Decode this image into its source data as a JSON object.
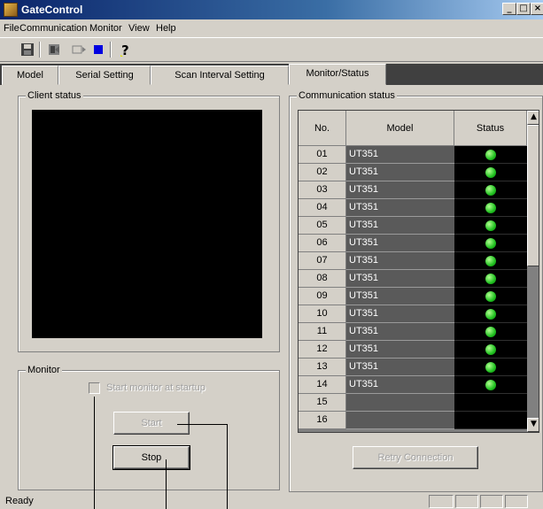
{
  "window": {
    "title": "GateControl"
  },
  "menu": [
    "File",
    "Communication",
    "Monitor",
    "View",
    "Help"
  ],
  "toolbar": [
    "save-icon",
    "tool-icon",
    "monitor-icon",
    "stop-icon",
    "help-icon"
  ],
  "tabs": [
    {
      "label": "Model",
      "active": false
    },
    {
      "label": "Serial Setting",
      "active": false
    },
    {
      "label": "Scan Interval Setting",
      "active": false
    },
    {
      "label": "Monitor/Status",
      "active": true
    }
  ],
  "client": {
    "group_label": "Client status"
  },
  "monitor": {
    "group_label": "Monitor",
    "startup_checkbox_label": "Start monitor at startup",
    "start_button": "Start",
    "stop_button": "Stop"
  },
  "communication": {
    "group_label": "Communication status",
    "headers": [
      "No.",
      "Model",
      "Status"
    ],
    "rows": [
      {
        "no": "01",
        "model": "UT351",
        "connected": true
      },
      {
        "no": "02",
        "model": "UT351",
        "connected": true
      },
      {
        "no": "03",
        "model": "UT351",
        "connected": true
      },
      {
        "no": "04",
        "model": "UT351",
        "connected": true
      },
      {
        "no": "05",
        "model": "UT351",
        "connected": true
      },
      {
        "no": "06",
        "model": "UT351",
        "connected": true
      },
      {
        "no": "07",
        "model": "UT351",
        "connected": true
      },
      {
        "no": "08",
        "model": "UT351",
        "connected": true
      },
      {
        "no": "09",
        "model": "UT351",
        "connected": true
      },
      {
        "no": "10",
        "model": "UT351",
        "connected": true
      },
      {
        "no": "11",
        "model": "UT351",
        "connected": true
      },
      {
        "no": "12",
        "model": "UT351",
        "connected": true
      },
      {
        "no": "13",
        "model": "UT351",
        "connected": true
      },
      {
        "no": "14",
        "model": "UT351",
        "connected": true
      },
      {
        "no": "15",
        "model": "",
        "connected": false
      },
      {
        "no": "16",
        "model": "",
        "connected": false
      }
    ],
    "retry_button": "Retry Connection"
  },
  "statusbar": {
    "text": "Ready"
  },
  "colors": {
    "led_on": "#20c020",
    "title_bar": "#0a246a",
    "model_cell": "#5a5a5a"
  }
}
